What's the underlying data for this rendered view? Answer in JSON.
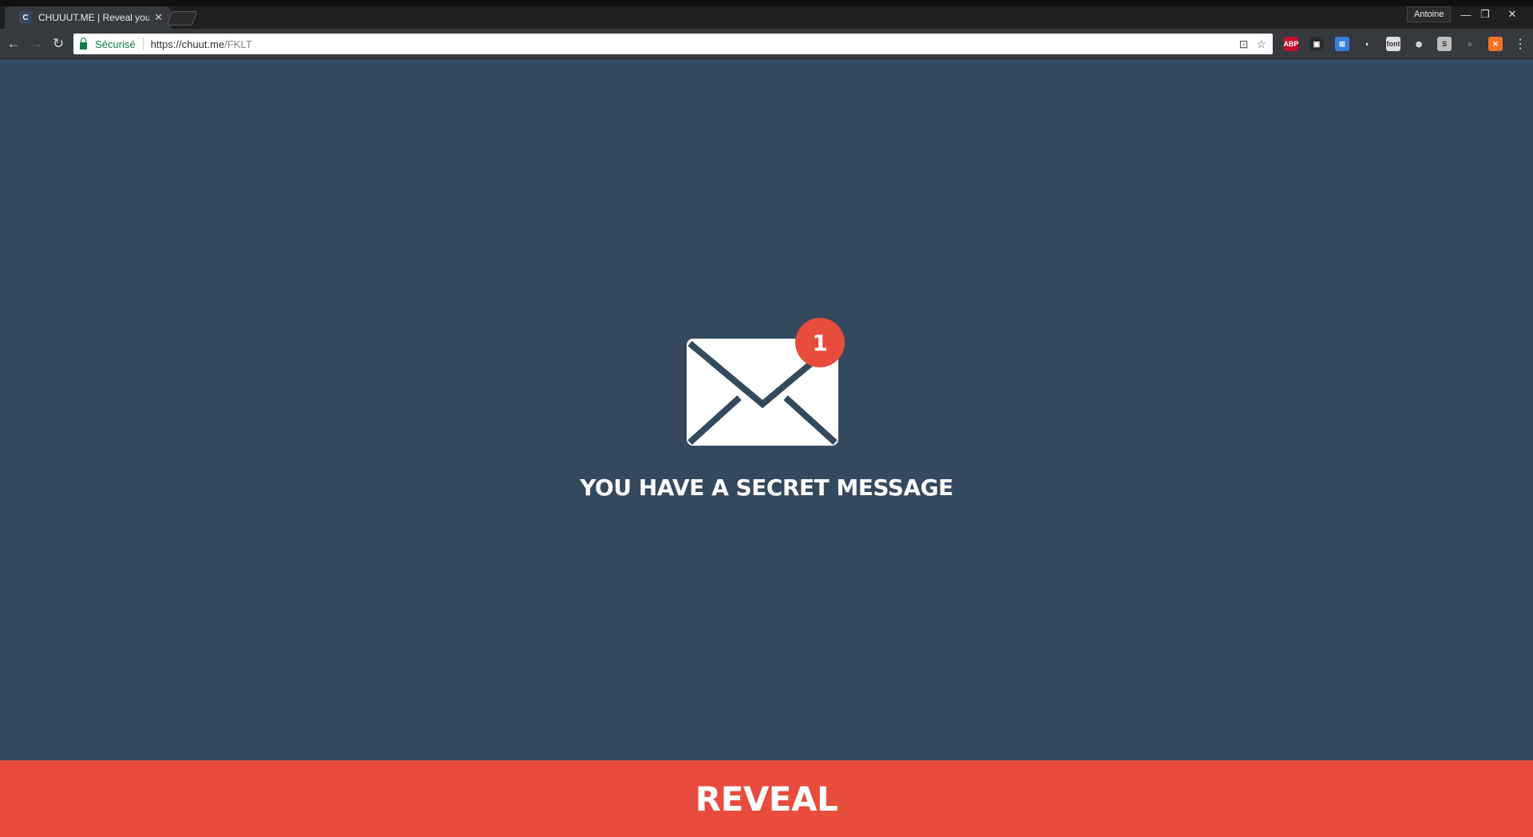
{
  "browser": {
    "tab_title": "CHUUUT.ME | Reveal your",
    "tab_favicon_letter": "C",
    "profile_name": "Antoine",
    "security_label": "Sécurisé",
    "url_main": "https://chuut.me",
    "url_path": "/FKLT",
    "icons": {
      "back": "back-arrow-icon",
      "forward": "forward-arrow-icon",
      "reload": "reload-icon",
      "translate": "translate-icon",
      "bookmark": "star-icon",
      "menu": "kebab-menu-icon"
    },
    "extensions": [
      {
        "name": "adblock-plus-extension",
        "label": "ABP",
        "color": "#c70d2c"
      },
      {
        "name": "extension-2",
        "label": "▣",
        "color": "#2b2b2b"
      },
      {
        "name": "extension-3",
        "label": "⊞",
        "color": "#3b7ddd"
      },
      {
        "name": "extension-4",
        "label": "◐",
        "color": "#36393d"
      },
      {
        "name": "font-extension",
        "label": "font",
        "color": "#e0e0e0"
      },
      {
        "name": "color-extension",
        "label": "◍",
        "color": "#36393d"
      },
      {
        "name": "s-extension",
        "label": "S",
        "color": "#bdbdbd"
      },
      {
        "name": "circle-extension",
        "label": "○",
        "color": "#36393d"
      },
      {
        "name": "orange-extension",
        "label": "✕",
        "color": "#f27321"
      }
    ]
  },
  "page": {
    "badge_count": "1",
    "headline": "YOU HAVE A SECRET MESSAGE",
    "reveal_label": "REVEAL",
    "colors": {
      "background": "#34495e",
      "accent": "#e74c3c",
      "envelope": "#ffffff"
    }
  }
}
